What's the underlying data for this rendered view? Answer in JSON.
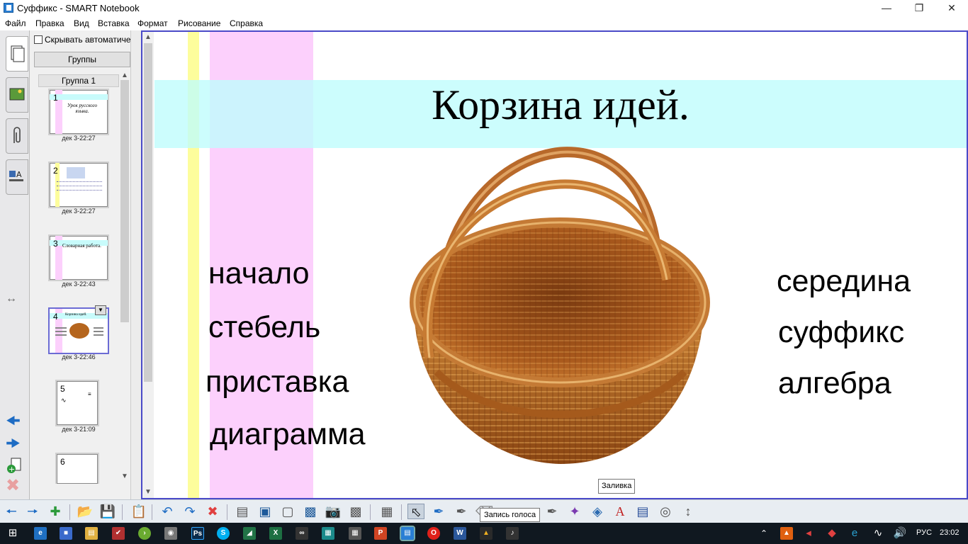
{
  "window": {
    "title": "Суффикс - SMART Notebook"
  },
  "menu": [
    "Файл",
    "Правка",
    "Вид",
    "Вставка",
    "Формат",
    "Рисование",
    "Справка"
  ],
  "sorter": {
    "autohide_label": "Скрывать автоматическ",
    "groups_button": "Группы",
    "group_label": "Группа 1",
    "pages": [
      {
        "num": "1",
        "date": "дек 3-22:27",
        "preview_text": "Урок русского языка."
      },
      {
        "num": "2",
        "date": "дек 3-22:27",
        "preview_text": ""
      },
      {
        "num": "3",
        "date": "дек 3-22:43",
        "preview_text": "Словарная работа."
      },
      {
        "num": "4",
        "date": "дек 3-22:46",
        "preview_text": "Корзина идей."
      },
      {
        "num": "5",
        "date": "дек 3-21:09",
        "preview_text": ""
      },
      {
        "num": "6",
        "date": "",
        "preview_text": ""
      }
    ]
  },
  "page": {
    "title": "Корзина идей.",
    "left_words": [
      "начало",
      "стебель",
      "приставка",
      "диаграмма"
    ],
    "right_words": [
      "середина",
      "суффикс",
      "алгебра"
    ],
    "tooltip": "Заливка"
  },
  "toolbar": {
    "voice_tooltip": "Запись голоса"
  },
  "taskbar": {
    "lang": "РУС",
    "time": "23:02"
  },
  "colors": {
    "title_band": "#befcfc",
    "pink_stripe": "#fcd0fc",
    "yellow_stripe": "#fdfd9c",
    "selection": "#4a4ac8"
  }
}
